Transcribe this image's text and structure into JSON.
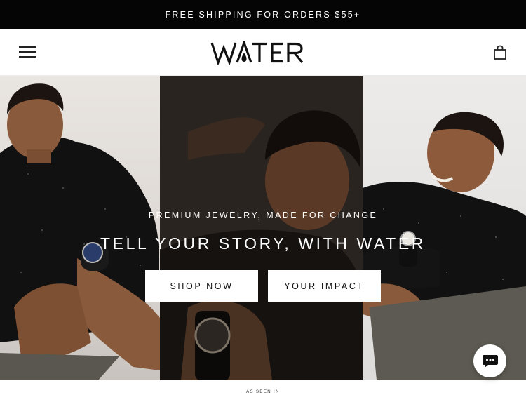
{
  "announcement": {
    "text": "FREE SHIPPING FOR ORDERS $55+"
  },
  "header": {
    "logo_text": "WATER",
    "icons": {
      "menu": "hamburger-menu-icon",
      "cart": "shopping-bag-icon"
    }
  },
  "hero": {
    "tagline": "PREMIUM JEWELRY, MADE FOR CHANGE",
    "headline": "TELL YOUR STORY, WITH WATER",
    "buttons": {
      "shop": "SHOP NOW",
      "impact": "YOUR IMPACT"
    },
    "images": [
      "model-left-photo",
      "model-center-photo",
      "model-right-photo"
    ]
  },
  "chat": {
    "icon": "chat-bubble-icon"
  },
  "footer_strip": {
    "label": "AS SEEN IN"
  },
  "colors": {
    "announce_bg": "#050505",
    "text_dark": "#111111",
    "button_bg": "#ffffff"
  }
}
